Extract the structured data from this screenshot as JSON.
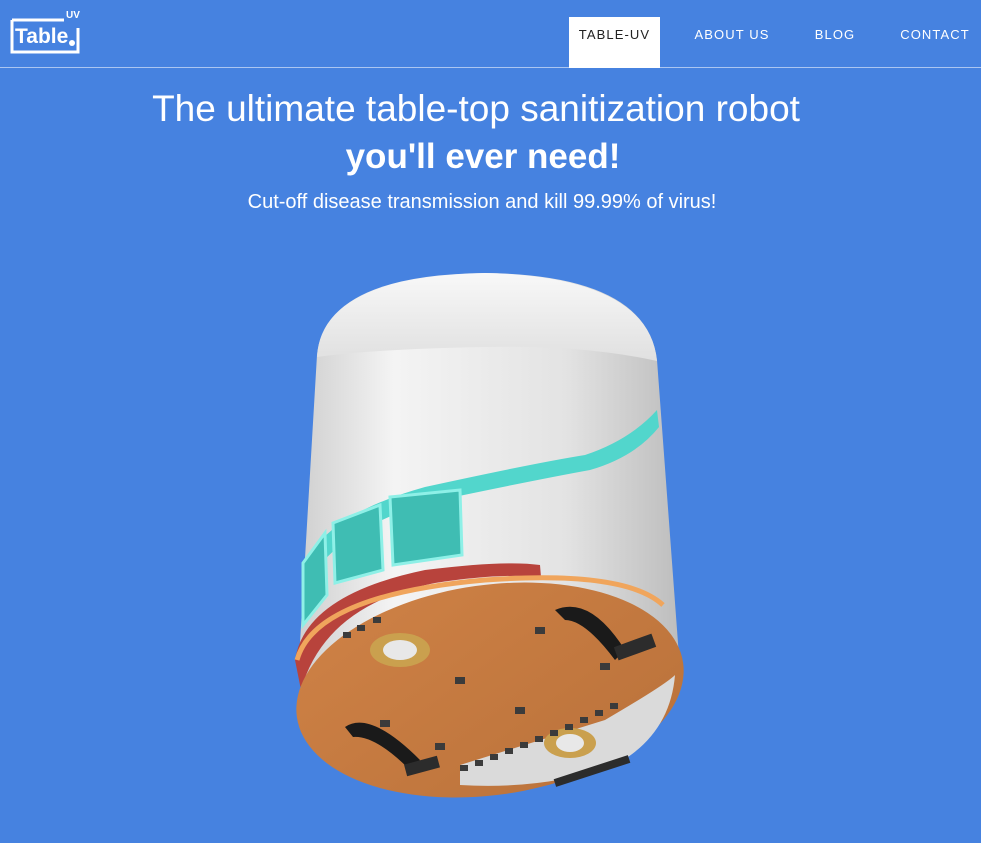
{
  "brand": {
    "logo_text": "Table",
    "logo_superscript": "UV"
  },
  "nav": {
    "items": [
      {
        "label": "TABLE-UV",
        "active": true
      },
      {
        "label": "ABOUT US",
        "active": false
      },
      {
        "label": "BLOG",
        "active": false
      },
      {
        "label": "CONTACT",
        "active": false
      }
    ]
  },
  "hero": {
    "headline_line1": "The ultimate table-top sanitization robot",
    "headline_line2": "you'll ever need!",
    "subheadline": "Cut-off disease transmission and kill 99.99% of virus!"
  },
  "colors": {
    "background": "#4682e0",
    "robot_body": "#e6e6e6",
    "robot_base": "#c97a3f",
    "accent_teal": "#52d6cc",
    "accent_red": "#b8433c"
  }
}
